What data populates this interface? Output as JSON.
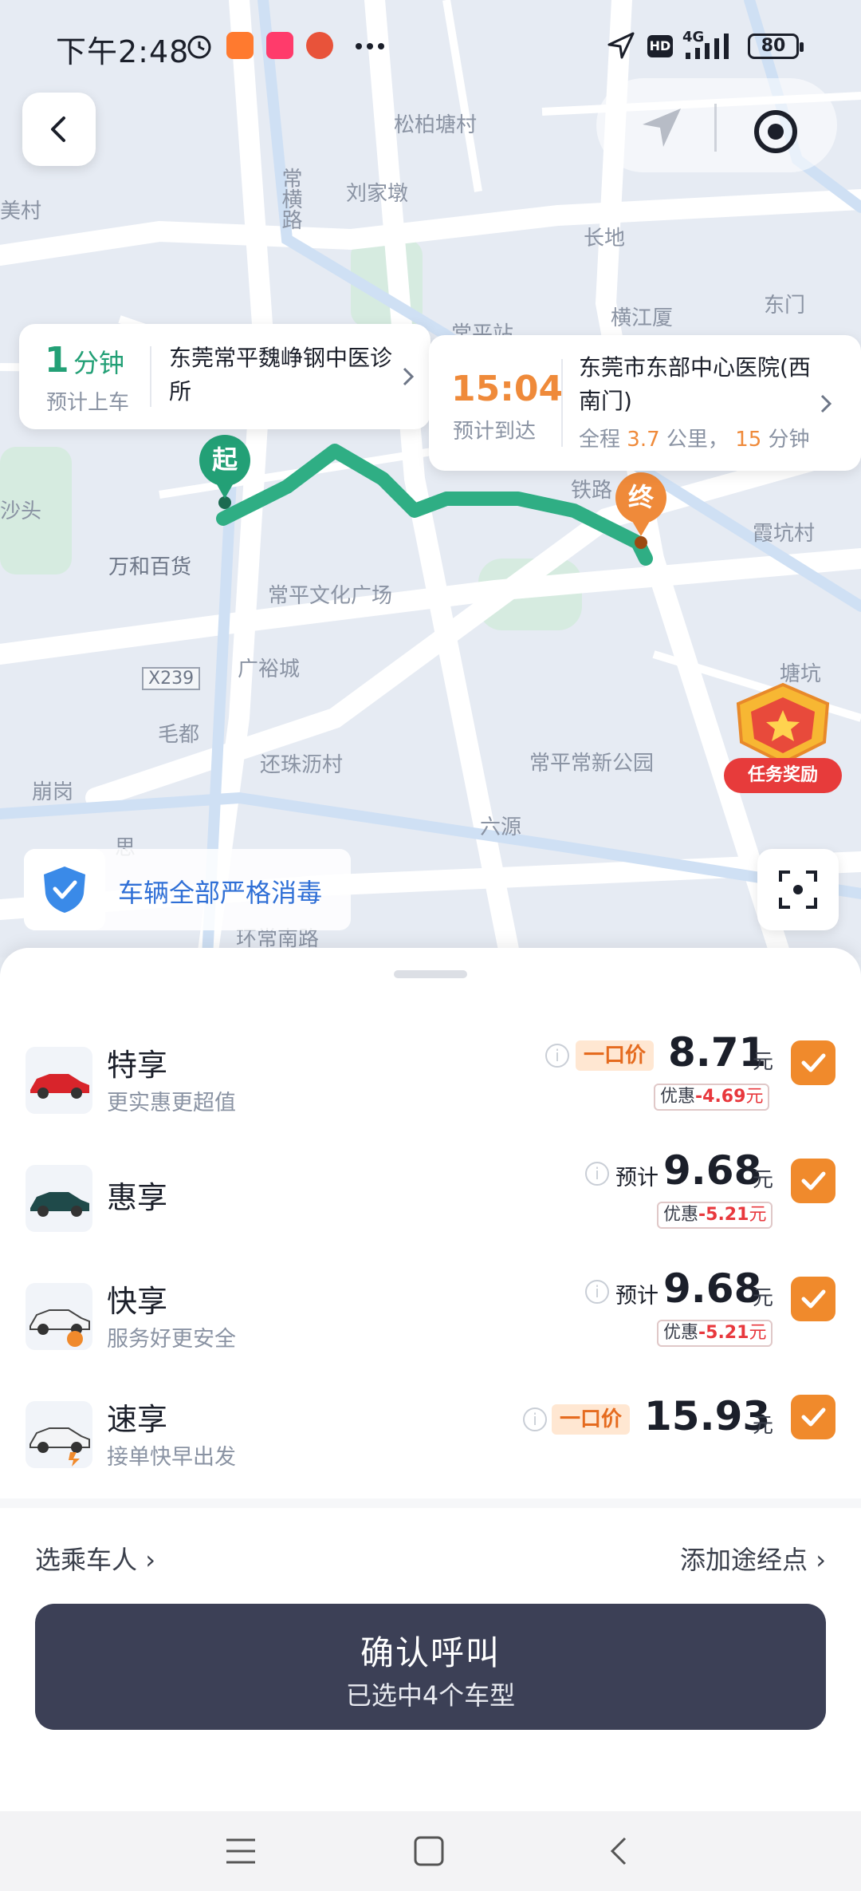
{
  "status_bar": {
    "time": "下午2:48",
    "network": "4G",
    "hd": "HD",
    "battery": "80"
  },
  "map": {
    "labels": [
      "松柏塘村",
      "刘家墩",
      "常横路",
      "长地",
      "东门",
      "横江厦",
      "常平站",
      "美村",
      "铁路",
      "霞坑村",
      "沙头",
      "万和百货",
      "常平文化广场",
      "广裕城",
      "X239",
      "毛都",
      "还珠沥村",
      "常平常新公园",
      "六源",
      "崩岗",
      "环常南路",
      "塘坑",
      "思"
    ],
    "start_marker": "起",
    "end_marker": "终",
    "task_reward": "任务奖励",
    "sanitize_text": "车辆全部严格消毒"
  },
  "pickup": {
    "eta_number": "1",
    "eta_unit": "分钟",
    "eta_label": "预计上车",
    "location": "东莞常平魏峥钢中医诊所"
  },
  "destination": {
    "arrival_time": "15:04",
    "arrival_label": "预计到达",
    "location": "东莞市东部中心医院(西南门)",
    "summary_prefix": "全程",
    "distance": "3.7",
    "distance_unit": "公里，",
    "duration": "15",
    "duration_unit": "分钟"
  },
  "car_options": [
    {
      "name": "特享",
      "subtitle": "更实惠更超值",
      "tag": "一口价",
      "price": "8.71",
      "unit": "元",
      "discount_label": "优惠",
      "discount": "-4.69",
      "discount_unit": "元",
      "checked": true
    },
    {
      "name": "惠享",
      "subtitle": "",
      "tag": "预计",
      "price": "9.68",
      "unit": "元",
      "discount_label": "优惠",
      "discount": "-5.21",
      "discount_unit": "元",
      "checked": true
    },
    {
      "name": "快享",
      "subtitle": "服务好更安全",
      "tag": "预计",
      "price": "9.68",
      "unit": "元",
      "discount_label": "优惠",
      "discount": "-5.21",
      "discount_unit": "元",
      "checked": true
    },
    {
      "name": "速享",
      "subtitle": "接单快早出发",
      "tag": "一口价",
      "price": "15.93",
      "unit": "元",
      "checked": true
    }
  ],
  "options": {
    "select_passenger": "选乘车人",
    "add_stop": "添加途经点"
  },
  "confirm": {
    "title": "确认呼叫",
    "subtitle": "已选中4个车型"
  },
  "colors": {
    "route": "#2fae84",
    "accent_orange": "#f08a2c",
    "confirm_bg": "#3c4056",
    "discount_red": "#e8383d"
  }
}
